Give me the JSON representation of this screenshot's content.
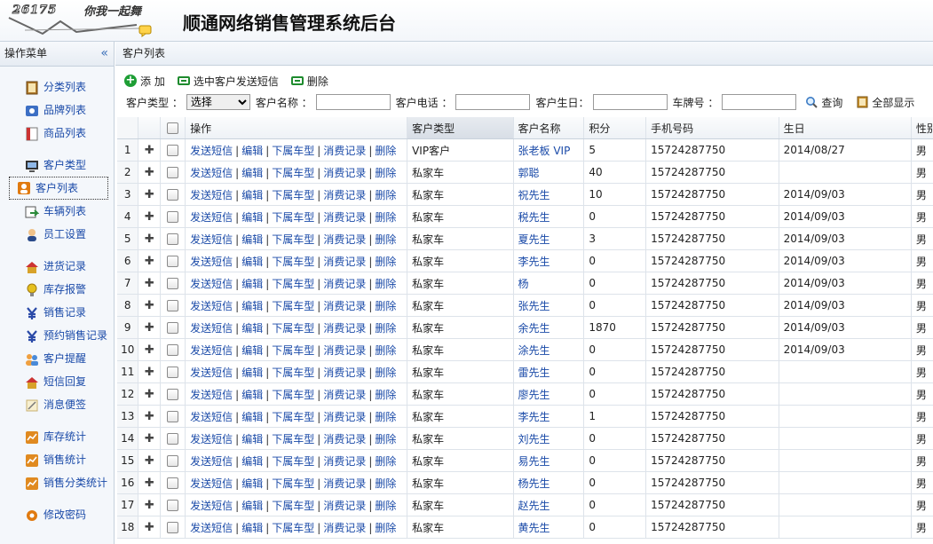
{
  "app": {
    "logo_number": "26175",
    "logo_slogan": "你我一起舞",
    "title": "顺通网络销售管理系统后台"
  },
  "sidebar": {
    "title": "操作菜单",
    "collapse_glyph": "«",
    "groups": [
      [
        {
          "label": "分类列表",
          "icon": "book-icon",
          "color": "#b07a2a"
        },
        {
          "label": "品牌列表",
          "icon": "brand-icon",
          "color": "#3c6fc4"
        },
        {
          "label": "商品列表",
          "icon": "product-icon",
          "color": "#c33"
        }
      ],
      [
        {
          "label": "客户类型",
          "icon": "monitor-icon",
          "color": "#555"
        },
        {
          "label": "客户列表",
          "icon": "customer-icon",
          "color": "#e07a10",
          "active": true
        },
        {
          "label": "车辆列表",
          "icon": "vehicle-icon",
          "color": "#2a8a3a"
        },
        {
          "label": "员工设置",
          "icon": "user-icon",
          "color": "#c47a2a"
        }
      ],
      [
        {
          "label": "进货记录",
          "icon": "house-icon",
          "color": "#d8a22a"
        },
        {
          "label": "库存报警",
          "icon": "bulb-icon",
          "color": "#e5c020"
        },
        {
          "label": "销售记录",
          "icon": "yen-icon",
          "color": "#2a4aa8"
        },
        {
          "label": "预约销售记录",
          "icon": "yen-icon",
          "color": "#2a4aa8"
        },
        {
          "label": "客户提醒",
          "icon": "people-icon",
          "color": "#d87a2a"
        },
        {
          "label": "短信回复",
          "icon": "house-icon",
          "color": "#d8a22a"
        },
        {
          "label": "消息便签",
          "icon": "note-icon",
          "color": "#c8b070"
        }
      ],
      [
        {
          "label": "库存统计",
          "icon": "chart-icon",
          "color": "#e08a20"
        },
        {
          "label": "销售统计",
          "icon": "chart-icon",
          "color": "#e08a20"
        },
        {
          "label": "销售分类统计",
          "icon": "chart-icon",
          "color": "#e08a20"
        }
      ],
      [
        {
          "label": "修改密码",
          "icon": "gear-icon",
          "color": "#e07a10"
        }
      ]
    ]
  },
  "main": {
    "breadcrumb": "客户列表",
    "toolbar": {
      "add": "添 加",
      "send_sms": "选中客户发送短信",
      "delete": "删除"
    },
    "search": {
      "type_label": "客户类型 ：",
      "type_value": "选择",
      "name_label": "客户名称 ：",
      "name_value": "",
      "phone_label": "客户电话 ：",
      "phone_value": "",
      "birthday_label": "客户生日：",
      "birthday_value": "",
      "plate_label": "车牌号 ：",
      "plate_value": "",
      "query": "查询",
      "show_all": "全部显示"
    },
    "table": {
      "columns": [
        "操作",
        "客户类型",
        "客户名称",
        "积分",
        "手机号码",
        "生日",
        "性别"
      ],
      "ops": [
        "发送短信",
        "编辑",
        "下属车型",
        "消费记录",
        "删除"
      ],
      "rows": [
        {
          "n": "1",
          "type": "VIP客户",
          "name": "张老板 VIP",
          "points": "5",
          "phone": "15724287750",
          "birthday": "2014/08/27",
          "gender": "男"
        },
        {
          "n": "2",
          "type": "私家车",
          "name": "郭聪",
          "points": "40",
          "phone": "15724287750",
          "birthday": "",
          "gender": "男"
        },
        {
          "n": "3",
          "type": "私家车",
          "name": "祝先生",
          "points": "10",
          "phone": "15724287750",
          "birthday": "2014/09/03",
          "gender": "男"
        },
        {
          "n": "4",
          "type": "私家车",
          "name": "税先生",
          "points": "0",
          "phone": "15724287750",
          "birthday": "2014/09/03",
          "gender": "男"
        },
        {
          "n": "5",
          "type": "私家车",
          "name": "夏先生",
          "points": "3",
          "phone": "15724287750",
          "birthday": "2014/09/03",
          "gender": "男"
        },
        {
          "n": "6",
          "type": "私家车",
          "name": "李先生",
          "points": "0",
          "phone": "15724287750",
          "birthday": "2014/09/03",
          "gender": "男"
        },
        {
          "n": "7",
          "type": "私家车",
          "name": "杨",
          "points": "0",
          "phone": "15724287750",
          "birthday": "2014/09/03",
          "gender": "男"
        },
        {
          "n": "8",
          "type": "私家车",
          "name": "张先生",
          "points": "0",
          "phone": "15724287750",
          "birthday": "2014/09/03",
          "gender": "男"
        },
        {
          "n": "9",
          "type": "私家车",
          "name": "余先生",
          "points": "1870",
          "phone": "15724287750",
          "birthday": "2014/09/03",
          "gender": "男"
        },
        {
          "n": "10",
          "type": "私家车",
          "name": "涂先生",
          "points": "0",
          "phone": "15724287750",
          "birthday": "2014/09/03",
          "gender": "男"
        },
        {
          "n": "11",
          "type": "私家车",
          "name": "雷先生",
          "points": "0",
          "phone": "15724287750",
          "birthday": "",
          "gender": "男"
        },
        {
          "n": "12",
          "type": "私家车",
          "name": "廖先生",
          "points": "0",
          "phone": "15724287750",
          "birthday": "",
          "gender": "男"
        },
        {
          "n": "13",
          "type": "私家车",
          "name": "李先生",
          "points": "1",
          "phone": "15724287750",
          "birthday": "",
          "gender": "男"
        },
        {
          "n": "14",
          "type": "私家车",
          "name": "刘先生",
          "points": "0",
          "phone": "15724287750",
          "birthday": "",
          "gender": "男"
        },
        {
          "n": "15",
          "type": "私家车",
          "name": "易先生",
          "points": "0",
          "phone": "15724287750",
          "birthday": "",
          "gender": "男"
        },
        {
          "n": "16",
          "type": "私家车",
          "name": "杨先生",
          "points": "0",
          "phone": "15724287750",
          "birthday": "",
          "gender": "男"
        },
        {
          "n": "17",
          "type": "私家车",
          "name": "赵先生",
          "points": "0",
          "phone": "15724287750",
          "birthday": "",
          "gender": "男"
        },
        {
          "n": "18",
          "type": "私家车",
          "name": "黄先生",
          "points": "0",
          "phone": "15724287750",
          "birthday": "",
          "gender": "男"
        }
      ]
    }
  }
}
